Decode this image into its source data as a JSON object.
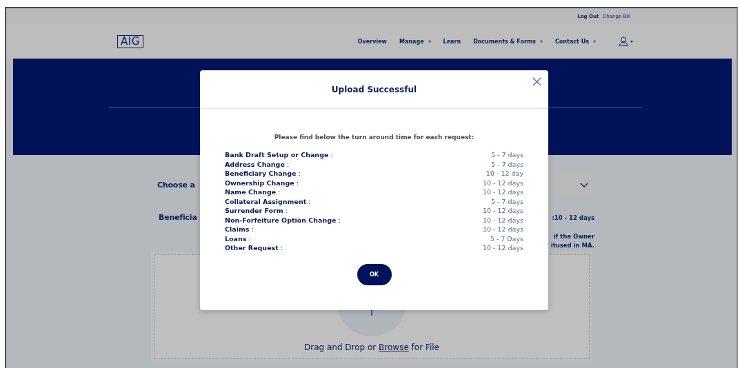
{
  "top_bar": {
    "links": [
      {
        "label": "Log Out",
        "kind": "strong"
      },
      {
        "label": "Change Bill",
        "kind": "plain"
      }
    ]
  },
  "header": {
    "logo": "AIG",
    "nav": [
      {
        "label": "Overview",
        "dropdown": false
      },
      {
        "label": "Manage",
        "dropdown": true
      },
      {
        "label": "Learn",
        "dropdown": false
      },
      {
        "label": "Documents & Forms",
        "dropdown": true
      },
      {
        "label": "Contact Us",
        "dropdown": true
      }
    ],
    "account_menu": {
      "dropdown": true
    }
  },
  "form": {
    "choose_label": "Choose a",
    "beneficiary_label": "Beneficia",
    "notes": [
      ":10 - 12 days",
      "if the Owner",
      "itused in MA."
    ],
    "upload": {
      "before": "Drag and Drop or ",
      "link": "Browse",
      "after": " for File"
    }
  },
  "modal": {
    "title": "Upload Successful",
    "intro": "Please find below the turn around time for each request:",
    "items": [
      {
        "request": "**Bank Draft Setup or Change** :",
        "time": "5 - 7 days"
      },
      {
        "request": "**Address Change** :",
        "time": "5 - 7 days"
      },
      {
        "request": "**Beneficiary Change** :",
        "time": "10 - 12 day"
      },
      {
        "request": "**Ownership Change** :",
        "time": "10 - 12 days"
      },
      {
        "request": "**Name Change** :",
        "time": "10 - 12 days"
      },
      {
        "request": "**Collateral Assignment** :",
        "time": "5 - 7 days"
      },
      {
        "request": "**Surrender Form** :",
        "time": "10 - 12 days"
      },
      {
        "request": "**Non-Forfeiture Option Change** :",
        "time": "10 - 12 days"
      },
      {
        "request": "**Claims** :",
        "time": "10 - 12 days"
      },
      {
        "request": "**Loans** :",
        "time": "5 - 7 Days"
      },
      {
        "request": "**Other Request** :",
        "time": "10 - 12 days"
      }
    ],
    "button": "OK"
  }
}
